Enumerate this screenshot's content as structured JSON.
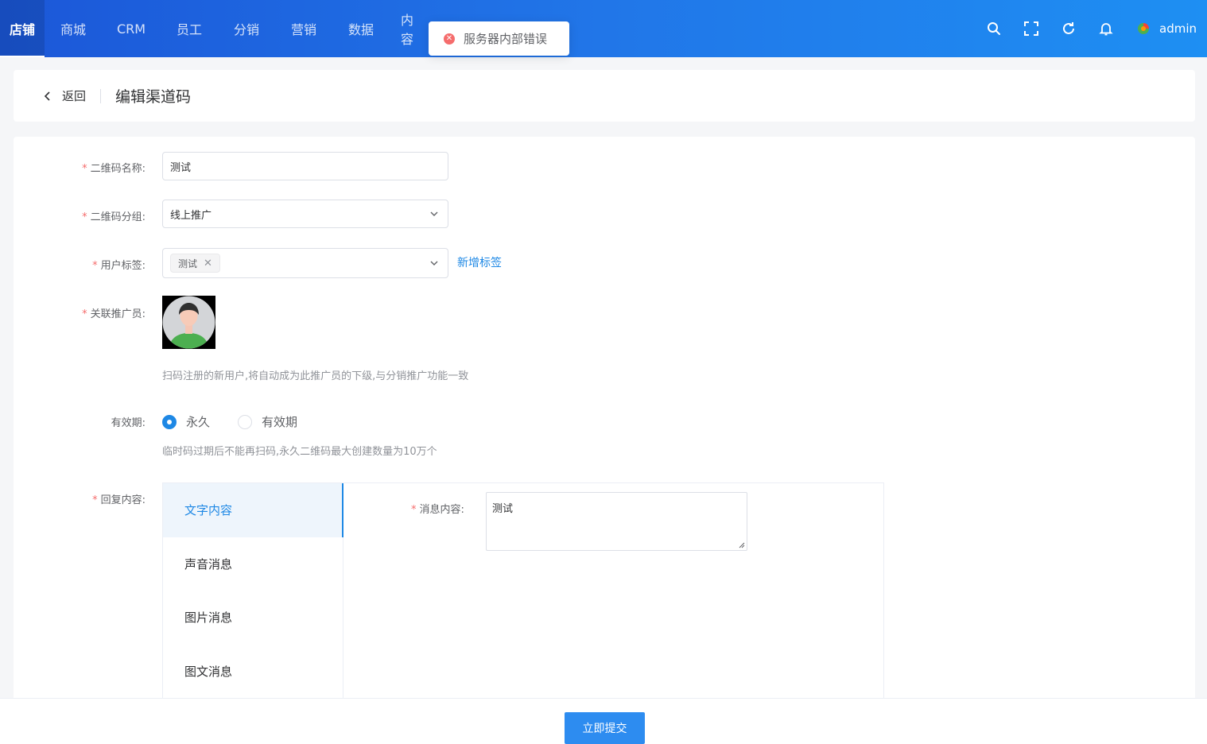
{
  "nav": {
    "items": [
      "店铺",
      "商城",
      "CRM",
      "员工",
      "分销",
      "营销",
      "数据",
      "内容"
    ],
    "active_index": 0
  },
  "user": {
    "name": "admin"
  },
  "toast": {
    "message": "服务器内部错误",
    "type": "error"
  },
  "header": {
    "back_label": "返回",
    "title": "编辑渠道码"
  },
  "form": {
    "qr_name": {
      "label": "二维码名称:",
      "value": "测试"
    },
    "qr_group": {
      "label": "二维码分组:",
      "value": "线上推广"
    },
    "user_tags": {
      "label": "用户标签:",
      "tags": [
        "测试"
      ],
      "add_link": "新增标签"
    },
    "promoter": {
      "label": "关联推广员:",
      "hint": "扫码注册的新用户,将自动成为此推广员的下级,与分销推广功能一致"
    },
    "validity": {
      "label": "有效期:",
      "options": [
        "永久",
        "有效期"
      ],
      "selected": "永久",
      "hint": "临时码过期后不能再扫码,永久二维码最大创建数量为10万个"
    },
    "reply": {
      "label": "回复内容:",
      "tabs": [
        "文字内容",
        "声音消息",
        "图片消息",
        "图文消息"
      ],
      "active_tab": "文字内容",
      "message_label": "消息内容:",
      "message_value": "测试"
    }
  },
  "footer": {
    "submit_label": "立即提交"
  },
  "colors": {
    "primary": "#1e88e5",
    "danger": "#f56c6c",
    "nav_start": "#1b57d8",
    "nav_end": "#1e8ff3"
  }
}
